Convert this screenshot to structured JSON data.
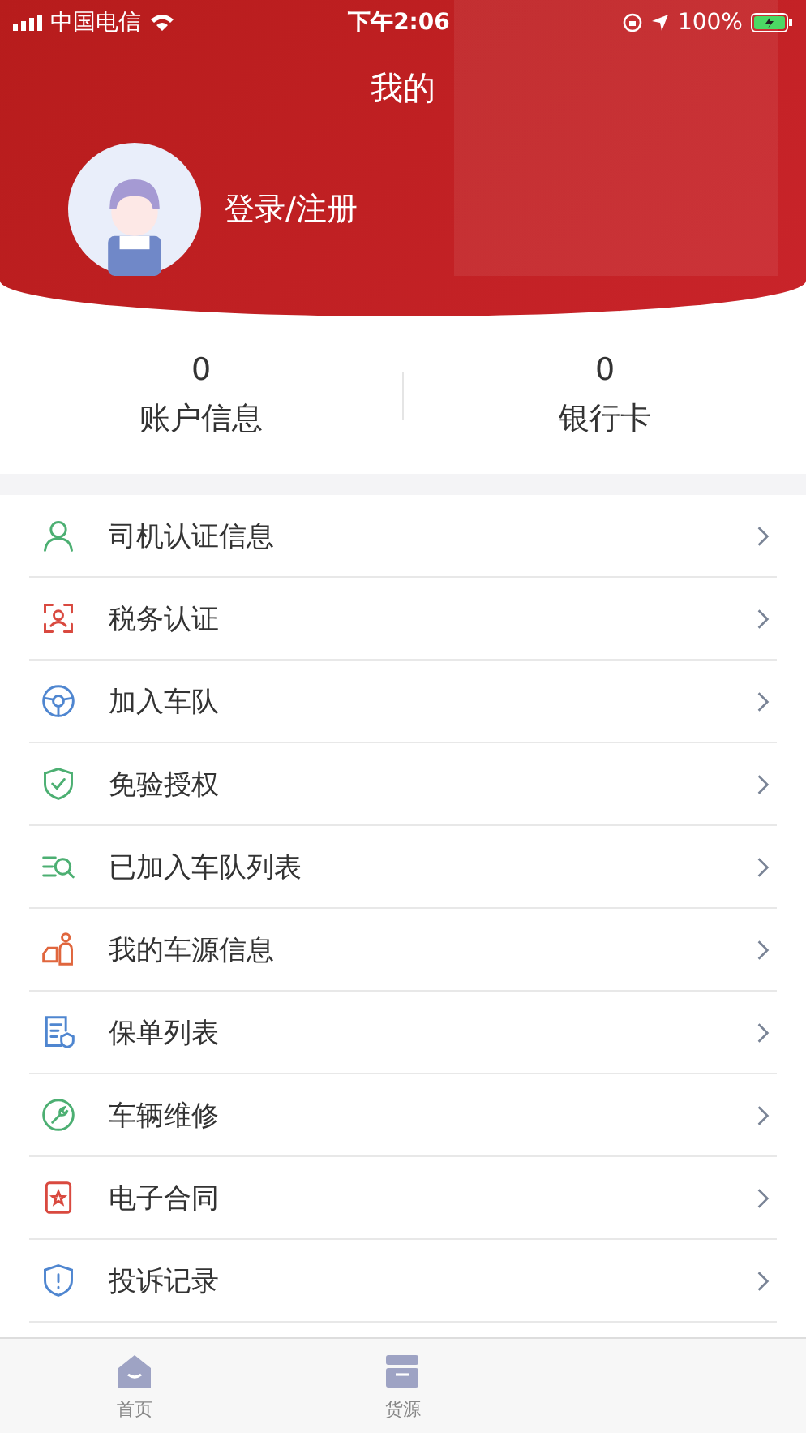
{
  "status_bar": {
    "carrier": "中国电信",
    "time": "下午2:06",
    "battery": "100%"
  },
  "header": {
    "title": "我的",
    "login": "登录/注册"
  },
  "stats": [
    {
      "value": "0",
      "label": "账户信息"
    },
    {
      "value": "0",
      "label": "银行卡"
    }
  ],
  "menu": [
    {
      "kind": "driver",
      "label": "司机认证信息"
    },
    {
      "kind": "tax",
      "label": "税务认证"
    },
    {
      "kind": "fleet",
      "label": "加入车队"
    },
    {
      "kind": "shield",
      "label": "免验授权"
    },
    {
      "kind": "search-list",
      "label": "已加入车队列表"
    },
    {
      "kind": "vehicle",
      "label": "我的车源信息"
    },
    {
      "kind": "policy",
      "label": "保单列表"
    },
    {
      "kind": "repair",
      "label": "车辆维修"
    },
    {
      "kind": "contract",
      "label": "电子合同"
    },
    {
      "kind": "complaint",
      "label": "投诉记录"
    }
  ],
  "tab_bar": [
    {
      "kind": "home",
      "label": "首页"
    },
    {
      "kind": "cargo",
      "label": "货源"
    }
  ]
}
